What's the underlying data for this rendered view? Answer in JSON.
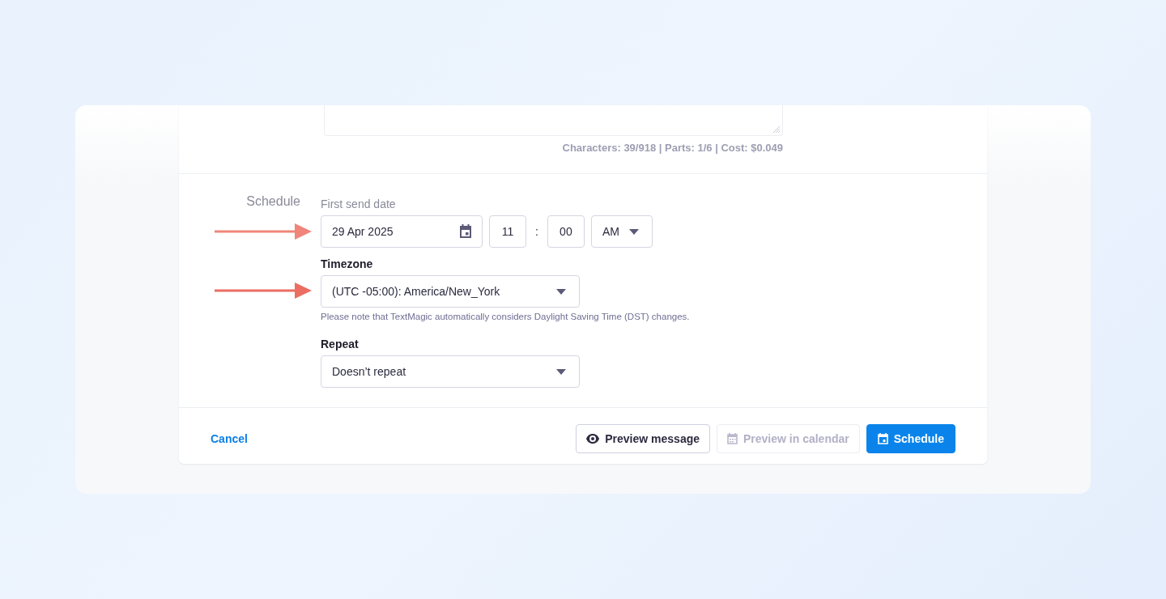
{
  "message": {
    "counter": "Characters: 39/918 | Parts: 1/6 | Cost: $0.049"
  },
  "schedule": {
    "section_label": "Schedule",
    "first_send_date": {
      "label": "First send date",
      "date": "29 Apr 2025",
      "hour": "11",
      "separator": ":",
      "minute": "00",
      "period": "AM"
    },
    "timezone": {
      "label": "Timezone",
      "value": "(UTC -05:00): America/New_York",
      "note": "Please note that TextMagic automatically considers Daylight Saving Time (DST) changes."
    },
    "repeat": {
      "label": "Repeat",
      "value": "Doesn’t repeat"
    }
  },
  "footer": {
    "cancel": "Cancel",
    "buttons": [
      {
        "label": "Preview message",
        "kind": "outline",
        "disabled": false
      },
      {
        "label": "Preview in calendar",
        "kind": "outline",
        "disabled": true
      },
      {
        "label": "Schedule",
        "kind": "primary",
        "disabled": false
      }
    ]
  }
}
